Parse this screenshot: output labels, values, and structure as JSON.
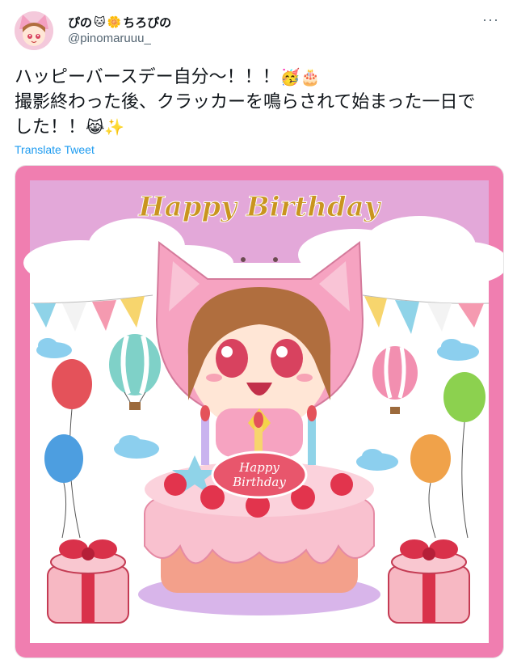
{
  "tweet": {
    "display_name": "ぴの",
    "display_name_emoji_1": "🐱",
    "display_name_emoji_2": "🌼",
    "display_name_suffix": "ちろぴの",
    "handle": "@pinomaruuu_",
    "more_label": "···",
    "text_line_1": "ハッピーバースデー自分〜！！！",
    "text_line_1_emoji": "🥳🎂",
    "text_line_2": "撮影終わった後、クラッカーを鳴らされて始まった一日で",
    "text_line_3": "した！！",
    "text_line_3_emoji": "😹✨",
    "translate_label": "Translate Tweet"
  },
  "image": {
    "title": "Happy Birthday",
    "plaque_line_1": "Happy",
    "plaque_line_2": "Birthday"
  },
  "colors": {
    "frame_pink": "#f07eb0",
    "sky_lilac": "#e3a8d9",
    "link_blue": "#1d9bf0"
  }
}
